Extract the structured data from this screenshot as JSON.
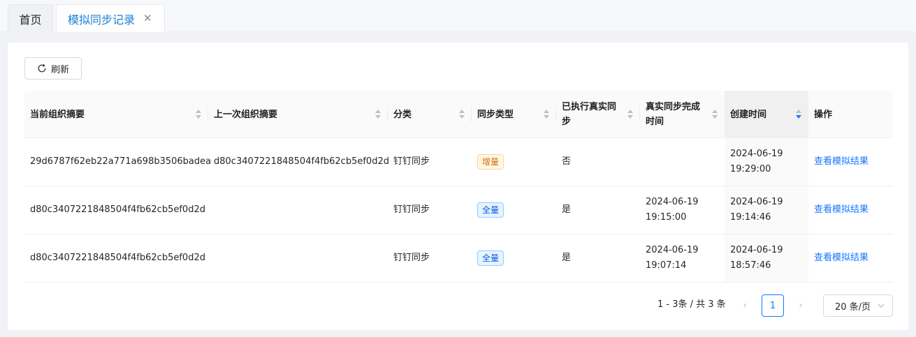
{
  "tabs": {
    "home": "首页",
    "active": "模拟同步记录",
    "close": "✕"
  },
  "toolbar": {
    "refresh_label": "刷新"
  },
  "table": {
    "columns": [
      {
        "label": "当前组织摘要"
      },
      {
        "label": "上一次组织摘要"
      },
      {
        "label": "分类"
      },
      {
        "label": "同步类型"
      },
      {
        "label": "已执行真实同步"
      },
      {
        "label": "真实同步完成时间"
      },
      {
        "label": "创建时间"
      },
      {
        "label": "操作"
      }
    ],
    "rows": [
      {
        "current_digest": "29d6787f62eb22a771a698b3506badea",
        "previous_digest": "d80c3407221848504f4fb62cb5ef0d2d",
        "category": "钉钉同步",
        "sync_type": "增量",
        "executed": "否",
        "done_date": "",
        "done_time": "",
        "created_date": "2024-06-19",
        "created_time": "19:29:00",
        "action": "查看模拟结果"
      },
      {
        "current_digest": "d80c3407221848504f4fb62cb5ef0d2d",
        "previous_digest": "",
        "category": "钉钉同步",
        "sync_type": "全量",
        "executed": "是",
        "done_date": "2024-06-19",
        "done_time": "19:15:00",
        "created_date": "2024-06-19",
        "created_time": "19:14:46",
        "action": "查看模拟结果"
      },
      {
        "current_digest": "d80c3407221848504f4fb62cb5ef0d2d",
        "previous_digest": "",
        "category": "钉钉同步",
        "sync_type": "全量",
        "executed": "是",
        "done_date": "2024-06-19",
        "done_time": "19:07:14",
        "created_date": "2024-06-19",
        "created_time": "18:57:46",
        "action": "查看模拟结果"
      }
    ]
  },
  "pagination": {
    "total_text": "1 - 3条 / 共 3 条",
    "current_page": "1",
    "prev": "‹",
    "next": "›",
    "page_size": "20 条/页"
  },
  "colors": {
    "primary": "#1677ff",
    "tag_incremental": "#d46b08",
    "tag_full": "#0958d9"
  }
}
